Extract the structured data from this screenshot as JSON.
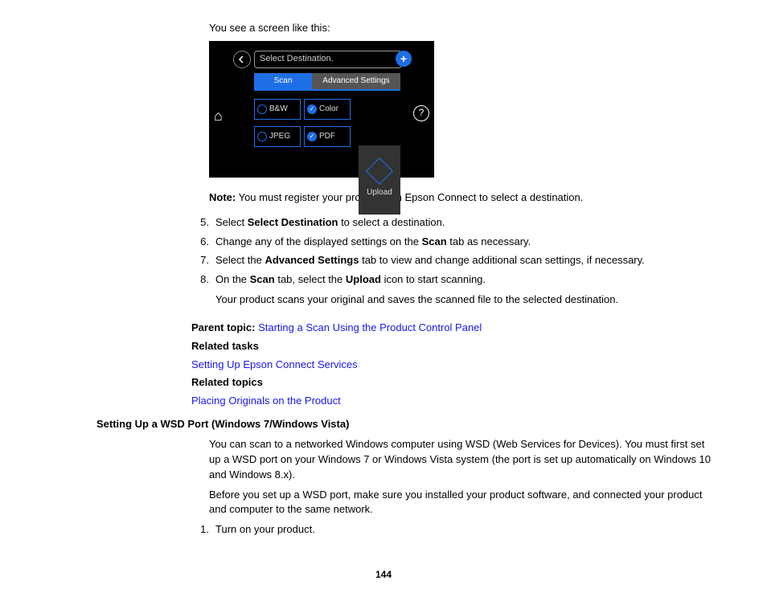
{
  "intro": "You see a screen like this:",
  "lcd": {
    "dest": "Select Destination.",
    "tab_scan": "Scan",
    "tab_adv": "Advanced Settings",
    "opt_bw": "B&W",
    "opt_color": "Color",
    "opt_jpeg": "JPEG",
    "opt_pdf": "PDF",
    "upload": "Upload"
  },
  "note": {
    "label": "Note:",
    "text": " You must register your product with Epson Connect to select a destination."
  },
  "steps": [
    {
      "n": "5.",
      "pre": "Select ",
      "b1": "Select Destination",
      "post": " to select a destination."
    },
    {
      "n": "6.",
      "pre": "Change any of the displayed settings on the ",
      "b1": "Scan",
      "post": " tab as necessary."
    },
    {
      "n": "7.",
      "pre": "Select the ",
      "b1": "Advanced Settings",
      "post": " tab to view and change additional scan settings, if necessary."
    },
    {
      "n": "8.",
      "pre": "On the ",
      "b1": "Scan",
      "mid": " tab, select the ",
      "b2": "Upload",
      "post": " icon to start scanning."
    }
  ],
  "after_steps": "Your product scans your original and saves the scanned file to the selected destination.",
  "parent": {
    "label": "Parent topic:",
    "link": "Starting a Scan Using the Product Control Panel"
  },
  "rel_tasks": {
    "label": "Related tasks",
    "link": "Setting Up Epson Connect Services"
  },
  "rel_topics": {
    "label": "Related topics",
    "link": "Placing Originals on the Product"
  },
  "wsd": {
    "heading": "Setting Up a WSD Port (Windows 7/Windows Vista)",
    "p1": "You can scan to a networked Windows computer using WSD (Web Services for Devices). You must first set up a WSD port on your Windows 7 or Windows Vista system (the port is set up automatically on Windows 10 and Windows 8.x).",
    "p2": "Before you set up a WSD port, make sure you installed your product software, and connected your product and computer to the same network.",
    "step1_n": "1.",
    "step1_t": "Turn on your product."
  },
  "page_num": "144"
}
